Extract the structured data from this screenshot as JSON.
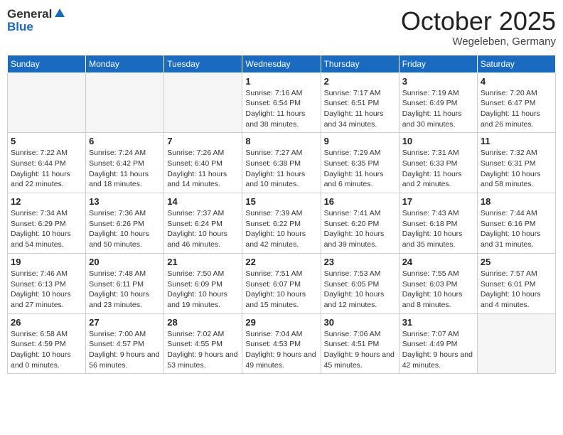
{
  "header": {
    "logo": {
      "general": "General",
      "blue": "Blue"
    },
    "month": "October 2025",
    "location": "Wegeleben, Germany"
  },
  "days_of_week": [
    "Sunday",
    "Monday",
    "Tuesday",
    "Wednesday",
    "Thursday",
    "Friday",
    "Saturday"
  ],
  "weeks": [
    [
      {
        "day": "",
        "info": ""
      },
      {
        "day": "",
        "info": ""
      },
      {
        "day": "",
        "info": ""
      },
      {
        "day": "1",
        "info": "Sunrise: 7:16 AM\nSunset: 6:54 PM\nDaylight: 11 hours and 38 minutes."
      },
      {
        "day": "2",
        "info": "Sunrise: 7:17 AM\nSunset: 6:51 PM\nDaylight: 11 hours and 34 minutes."
      },
      {
        "day": "3",
        "info": "Sunrise: 7:19 AM\nSunset: 6:49 PM\nDaylight: 11 hours and 30 minutes."
      },
      {
        "day": "4",
        "info": "Sunrise: 7:20 AM\nSunset: 6:47 PM\nDaylight: 11 hours and 26 minutes."
      }
    ],
    [
      {
        "day": "5",
        "info": "Sunrise: 7:22 AM\nSunset: 6:44 PM\nDaylight: 11 hours and 22 minutes."
      },
      {
        "day": "6",
        "info": "Sunrise: 7:24 AM\nSunset: 6:42 PM\nDaylight: 11 hours and 18 minutes."
      },
      {
        "day": "7",
        "info": "Sunrise: 7:26 AM\nSunset: 6:40 PM\nDaylight: 11 hours and 14 minutes."
      },
      {
        "day": "8",
        "info": "Sunrise: 7:27 AM\nSunset: 6:38 PM\nDaylight: 11 hours and 10 minutes."
      },
      {
        "day": "9",
        "info": "Sunrise: 7:29 AM\nSunset: 6:35 PM\nDaylight: 11 hours and 6 minutes."
      },
      {
        "day": "10",
        "info": "Sunrise: 7:31 AM\nSunset: 6:33 PM\nDaylight: 11 hours and 2 minutes."
      },
      {
        "day": "11",
        "info": "Sunrise: 7:32 AM\nSunset: 6:31 PM\nDaylight: 10 hours and 58 minutes."
      }
    ],
    [
      {
        "day": "12",
        "info": "Sunrise: 7:34 AM\nSunset: 6:29 PM\nDaylight: 10 hours and 54 minutes."
      },
      {
        "day": "13",
        "info": "Sunrise: 7:36 AM\nSunset: 6:26 PM\nDaylight: 10 hours and 50 minutes."
      },
      {
        "day": "14",
        "info": "Sunrise: 7:37 AM\nSunset: 6:24 PM\nDaylight: 10 hours and 46 minutes."
      },
      {
        "day": "15",
        "info": "Sunrise: 7:39 AM\nSunset: 6:22 PM\nDaylight: 10 hours and 42 minutes."
      },
      {
        "day": "16",
        "info": "Sunrise: 7:41 AM\nSunset: 6:20 PM\nDaylight: 10 hours and 39 minutes."
      },
      {
        "day": "17",
        "info": "Sunrise: 7:43 AM\nSunset: 6:18 PM\nDaylight: 10 hours and 35 minutes."
      },
      {
        "day": "18",
        "info": "Sunrise: 7:44 AM\nSunset: 6:16 PM\nDaylight: 10 hours and 31 minutes."
      }
    ],
    [
      {
        "day": "19",
        "info": "Sunrise: 7:46 AM\nSunset: 6:13 PM\nDaylight: 10 hours and 27 minutes."
      },
      {
        "day": "20",
        "info": "Sunrise: 7:48 AM\nSunset: 6:11 PM\nDaylight: 10 hours and 23 minutes."
      },
      {
        "day": "21",
        "info": "Sunrise: 7:50 AM\nSunset: 6:09 PM\nDaylight: 10 hours and 19 minutes."
      },
      {
        "day": "22",
        "info": "Sunrise: 7:51 AM\nSunset: 6:07 PM\nDaylight: 10 hours and 15 minutes."
      },
      {
        "day": "23",
        "info": "Sunrise: 7:53 AM\nSunset: 6:05 PM\nDaylight: 10 hours and 12 minutes."
      },
      {
        "day": "24",
        "info": "Sunrise: 7:55 AM\nSunset: 6:03 PM\nDaylight: 10 hours and 8 minutes."
      },
      {
        "day": "25",
        "info": "Sunrise: 7:57 AM\nSunset: 6:01 PM\nDaylight: 10 hours and 4 minutes."
      }
    ],
    [
      {
        "day": "26",
        "info": "Sunrise: 6:58 AM\nSunset: 4:59 PM\nDaylight: 10 hours and 0 minutes."
      },
      {
        "day": "27",
        "info": "Sunrise: 7:00 AM\nSunset: 4:57 PM\nDaylight: 9 hours and 56 minutes."
      },
      {
        "day": "28",
        "info": "Sunrise: 7:02 AM\nSunset: 4:55 PM\nDaylight: 9 hours and 53 minutes."
      },
      {
        "day": "29",
        "info": "Sunrise: 7:04 AM\nSunset: 4:53 PM\nDaylight: 9 hours and 49 minutes."
      },
      {
        "day": "30",
        "info": "Sunrise: 7:06 AM\nSunset: 4:51 PM\nDaylight: 9 hours and 45 minutes."
      },
      {
        "day": "31",
        "info": "Sunrise: 7:07 AM\nSunset: 4:49 PM\nDaylight: 9 hours and 42 minutes."
      },
      {
        "day": "",
        "info": ""
      }
    ]
  ]
}
